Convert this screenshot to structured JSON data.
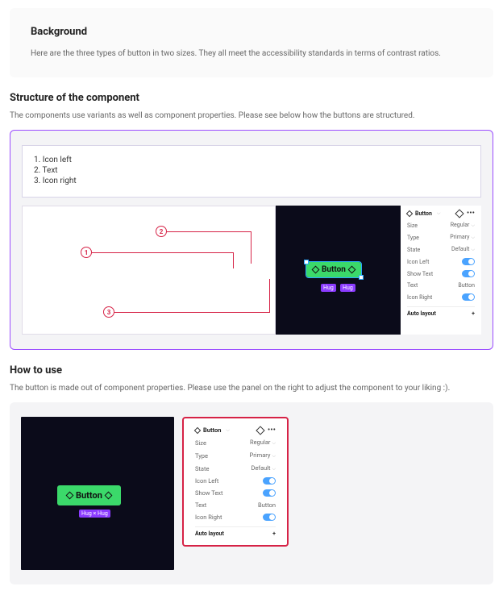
{
  "background": {
    "title": "Background",
    "text": "Here are the three types of button in two sizes. They all meet the accessibility standards in terms of contrast ratios."
  },
  "structure": {
    "title": "Structure of the component",
    "text": "The components use variants as well as component properties. Please see below how the buttons are structured.",
    "legend": [
      "1. Icon left",
      "2. Text",
      "3. Icon right"
    ],
    "markers": {
      "m1": "1",
      "m2": "2",
      "m3": "3"
    },
    "button_label": "Button",
    "hug1": "Hug",
    "hug2": "Hug"
  },
  "howto": {
    "title": "How to use",
    "text": "The button is made out of component properties. Please use the panel on the right to adjust the component to your liking :).",
    "button_label": "Button",
    "hug": "Hug × Hug"
  },
  "props": {
    "component": "Button",
    "rows": {
      "size": {
        "label": "Size",
        "value": "Regular"
      },
      "type": {
        "label": "Type",
        "value": "Primary"
      },
      "state": {
        "label": "State",
        "value": "Default"
      },
      "iconLeft": {
        "label": "Icon Left"
      },
      "showText": {
        "label": "Show Text"
      },
      "text": {
        "label": "Text",
        "value": "Button"
      },
      "iconRight": {
        "label": "Icon Right"
      }
    },
    "autolayout": "Auto layout",
    "plus": "+"
  }
}
